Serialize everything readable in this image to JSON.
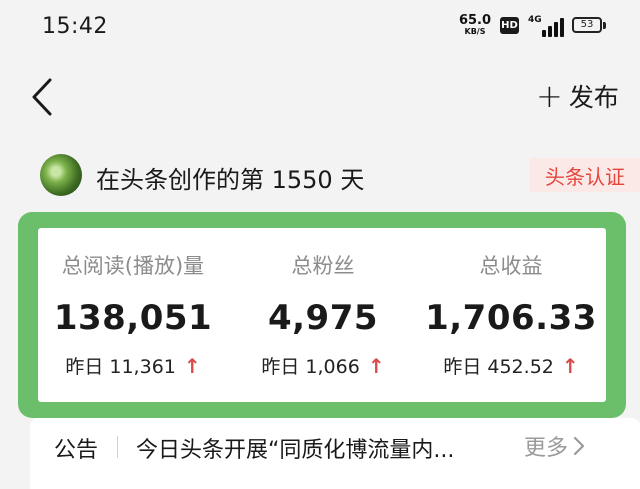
{
  "status_bar": {
    "time": "15:42",
    "net_speed_value": "65.0",
    "net_speed_unit": "KB/S",
    "hd_label": "HD",
    "network_type": "4G",
    "battery_level": "53"
  },
  "header": {
    "back_icon": "chevron-left-icon",
    "publish_icon": "plus-icon",
    "publish_label": "发布"
  },
  "creator": {
    "avatar_icon": "avatar",
    "days_text": "在头条创作的第 1550 天",
    "certification_label": "头条认证"
  },
  "stats": {
    "accent_color": "#6bbf6b",
    "items": [
      {
        "label": "总阅读(播放)量",
        "value": "138,051",
        "yesterday": "昨日 11,361"
      },
      {
        "label": "总粉丝",
        "value": "4,975",
        "yesterday": "昨日 1,066"
      },
      {
        "label": "总收益",
        "value": "1,706.33",
        "yesterday": "昨日 452.52"
      }
    ],
    "up_arrow": "↑",
    "up_color": "#d94a4a"
  },
  "notice": {
    "label": "公告",
    "text": "今日头条开展“同质化博流量内...",
    "more_label": "更多",
    "more_icon": "chevron-right-icon"
  }
}
